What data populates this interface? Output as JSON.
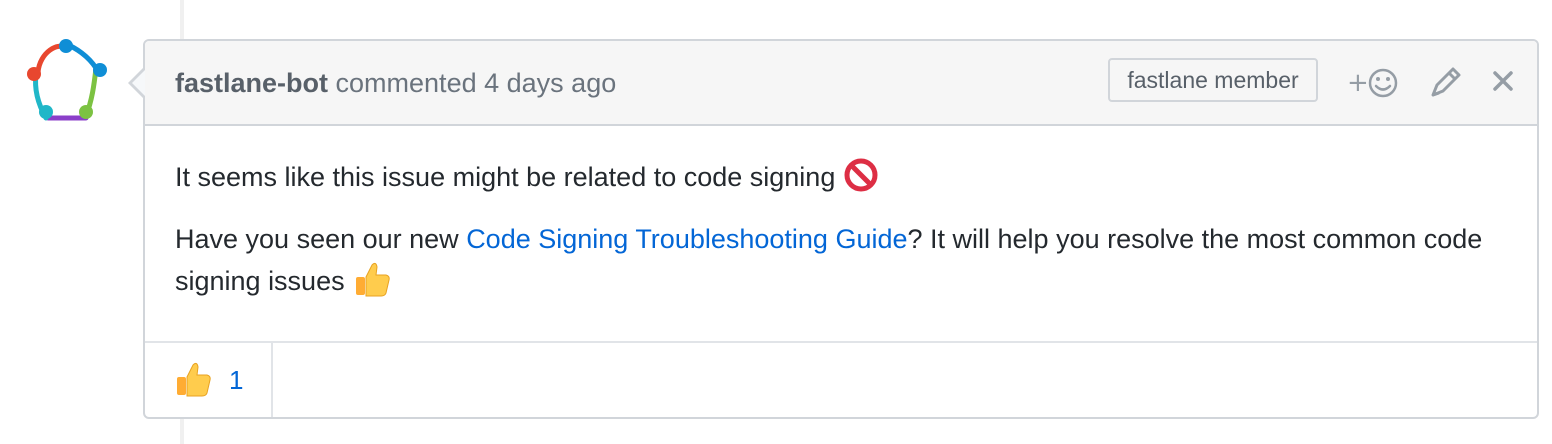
{
  "comment": {
    "author": "fastlane-bot",
    "action_text": "commented",
    "timestamp": "4 days ago",
    "badge": "fastlane member",
    "actions": {
      "add_reaction_icon": "add-reaction-icon",
      "edit_icon": "pencil-icon",
      "delete_icon": "close-icon"
    },
    "body": {
      "line1": "It seems like this issue might be related to code signing",
      "line1_emoji": "no-entry-icon",
      "line2_before": "Have you seen our new ",
      "link_text": "Code Signing Troubleshooting Guide",
      "line2_after": "? It will help you resolve the most common code signing issues",
      "line2_emoji": "thumbs-up-icon"
    },
    "reactions": [
      {
        "emoji": "thumbs-up-icon",
        "count": "1"
      }
    ]
  },
  "colors": {
    "link": "#0366d6",
    "header_bg": "#f6f6f6",
    "border": "#d1d5da"
  }
}
